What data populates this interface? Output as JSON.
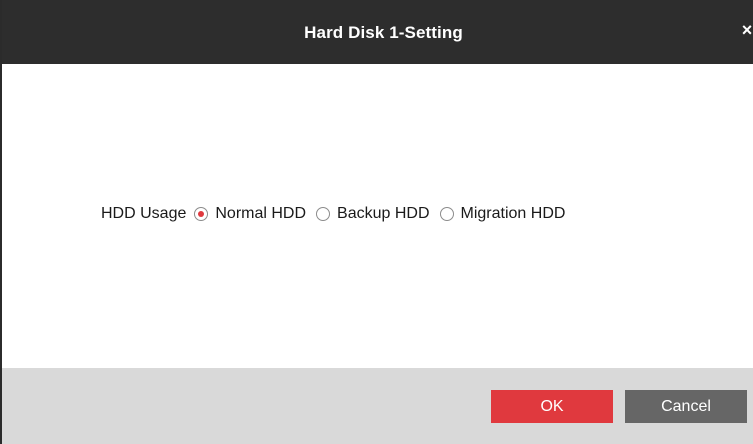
{
  "dialog": {
    "title": "Hard Disk 1-Setting",
    "close_glyph": "×"
  },
  "hdd_usage": {
    "label": "HDD Usage",
    "selected": "Normal HDD",
    "options": [
      {
        "label": "Normal HDD",
        "checked": true
      },
      {
        "label": "Backup HDD",
        "checked": false
      },
      {
        "label": "Migration HDD",
        "checked": false
      }
    ]
  },
  "footer": {
    "ok_label": "OK",
    "cancel_label": "Cancel"
  },
  "colors": {
    "titlebar": "#2d2d2d",
    "accent": "#e0393e",
    "footer_bg": "#d9d9d9",
    "cancel_button": "#666666"
  }
}
